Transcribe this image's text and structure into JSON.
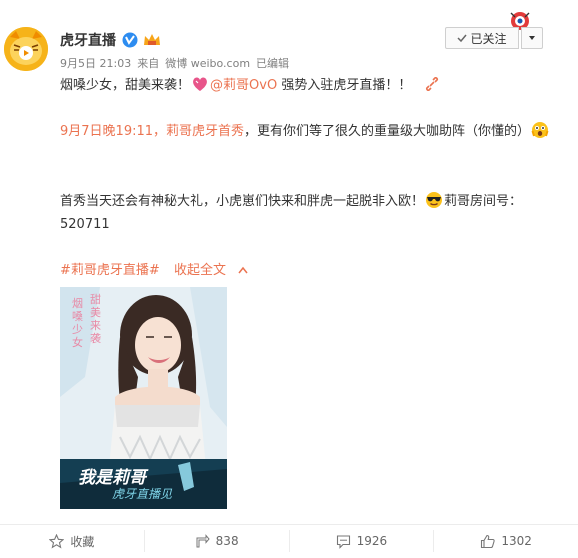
{
  "header": {
    "nickname": "虎牙直播",
    "date": "9月5日 21:03",
    "source_prefix": "来自",
    "source": "微博 weibo.com",
    "edited": "已编辑",
    "follow_label": "已关注"
  },
  "post": {
    "line1_a": "烟嗓少女，甜美来袭！",
    "mention": "@莉哥OvO",
    "line1_b": " 强势入驻虎牙直播！！",
    "line2_link": "9月7日晚19:11，莉哥虎牙首秀",
    "line2_rest": "，更有你们等了很久的重量级大咖助阵（你懂的）",
    "line3_a": "首秀当天还会有神秘大礼，小虎崽们快来和胖虎一起脱非入欧！",
    "line3_b": "莉哥房间号：520711",
    "hashtag": "#莉哥虎牙直播#",
    "collapse": "收起全文"
  },
  "photo": {
    "side_text_1": "甜美来袭",
    "side_text_2": "烟嗓少女",
    "banner_1": "我是莉哥",
    "banner_2": "虎牙直播见"
  },
  "footer": {
    "favorite": "收藏",
    "repost": "838",
    "comment": "1926",
    "like": "1302"
  },
  "colors": {
    "link": "#eb7350",
    "text": "#333333",
    "meta": "#808080",
    "verified": "#2d8cf0"
  },
  "icons": [
    "avatar-tiger",
    "verified-icon",
    "member-icon",
    "plus-icon",
    "heart-emoji",
    "scared-emoji",
    "sunglasses-emoji",
    "link-icon",
    "star-icon",
    "repost-icon",
    "comment-icon",
    "like-icon",
    "chevron-down-icon",
    "chevron-up-icon"
  ]
}
